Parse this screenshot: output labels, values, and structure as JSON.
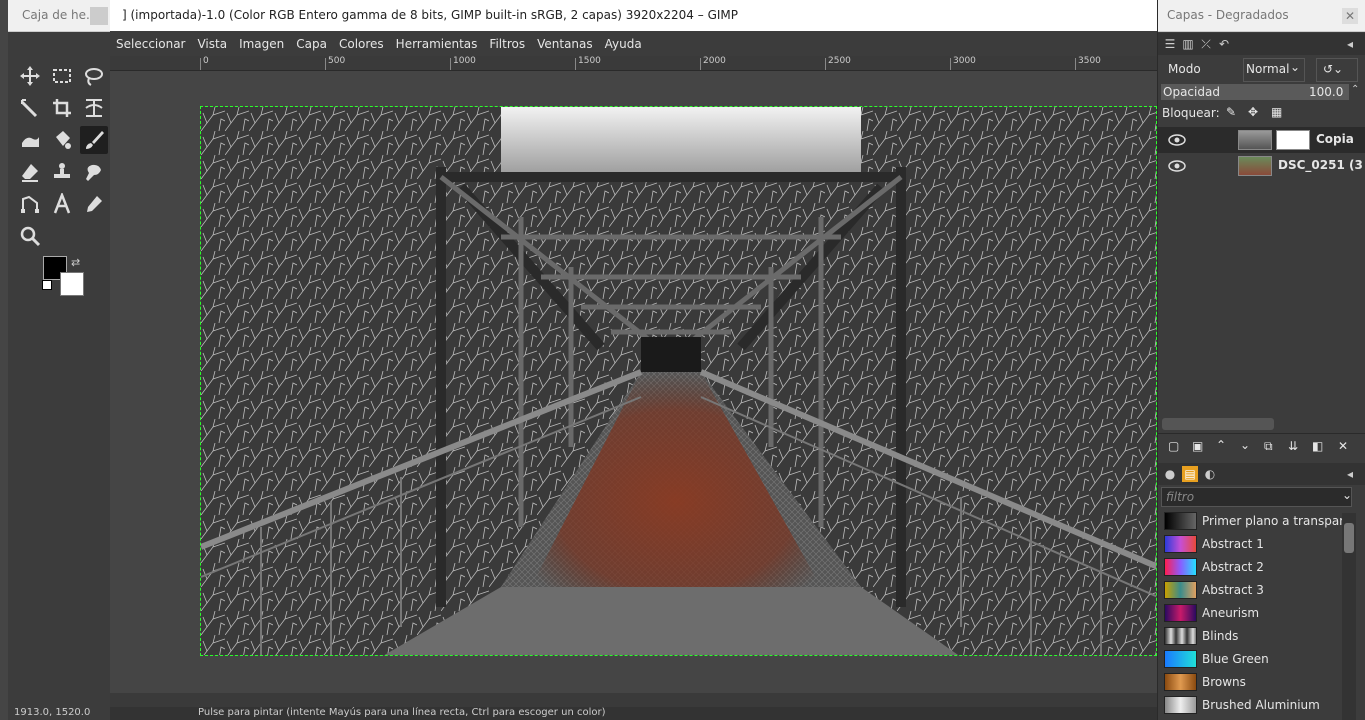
{
  "toolbox": {
    "title": "Caja de he...",
    "tools": [
      "move",
      "rect-select",
      "free-select",
      "measure",
      "crop",
      "warp",
      "smudge",
      "bucket",
      "paintbrush",
      "eraser",
      "clone",
      "heal",
      "path",
      "text",
      "color-picker",
      "zoom"
    ],
    "fg_color": "#000000",
    "bg_color": "#ffffff"
  },
  "image_window": {
    "title": "] (importada)-1.0 (Color RGB Entero gamma de 8 bits, GIMP built-in sRGB, 2 capas) 3920x2204 – GIMP",
    "menu": [
      "Seleccionar",
      "Vista",
      "Imagen",
      "Capa",
      "Colores",
      "Herramientas",
      "Filtros",
      "Ventanas",
      "Ayuda"
    ],
    "ruler_labels": [
      "0",
      "500",
      "1000",
      "1500",
      "2000",
      "2500",
      "3000",
      "3500"
    ],
    "status_left": "1913.0, 1520.0",
    "status_hint": "Pulse para pintar (intente Mayús para una línea recta, Ctrl para escoger un color)"
  },
  "dock": {
    "title": "Capas - Degradados",
    "mode_label": "Modo",
    "mode_value": "Normal",
    "opacity_label": "Opacidad",
    "opacity_value": "100.0",
    "lock_label": "Bloquear:",
    "layers": [
      {
        "name": "Copia",
        "visible": true,
        "active": true
      },
      {
        "name": "DSC_0251 (3",
        "visible": true,
        "active": false
      }
    ],
    "filter_placeholder": "filtro",
    "gradients": [
      {
        "name": "Primer plano a transpar",
        "colors": [
          "#000000",
          "#555555"
        ]
      },
      {
        "name": "Abstract 1",
        "colors": [
          "#2b3bd9",
          "#c54fd6",
          "#e84a3a"
        ]
      },
      {
        "name": "Abstract 2",
        "colors": [
          "#ff1e50",
          "#8a5cff",
          "#24e0ff"
        ]
      },
      {
        "name": "Abstract 3",
        "colors": [
          "#c8a000",
          "#3a8c8c",
          "#e0a060"
        ]
      },
      {
        "name": "Aneurism",
        "colors": [
          "#2a0a60",
          "#c81a6a",
          "#2a0a60"
        ]
      },
      {
        "name": "Blinds",
        "colors": [
          "#333333",
          "#dddddd",
          "#333333"
        ]
      },
      {
        "name": "Blue Green",
        "colors": [
          "#1a7aff",
          "#20e0d8"
        ]
      },
      {
        "name": "Browns",
        "colors": [
          "#8a4a10",
          "#e09a50",
          "#8a4a10"
        ]
      },
      {
        "name": "Brushed Aluminium",
        "colors": [
          "#888888",
          "#eeeeee",
          "#999999"
        ]
      }
    ]
  }
}
